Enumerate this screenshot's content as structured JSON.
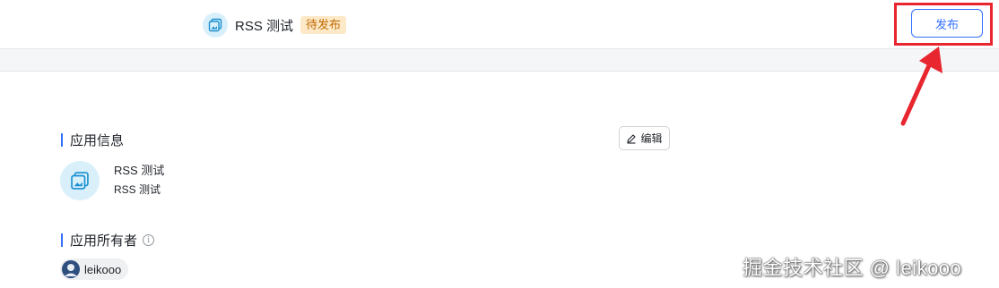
{
  "header": {
    "app_title": "RSS 测试",
    "status_badge": "待发布",
    "publish_label": "发布"
  },
  "app_info": {
    "section_title": "应用信息",
    "edit_label": "编辑",
    "app_name": "RSS 测试",
    "app_description": "RSS 测试"
  },
  "owner": {
    "section_title": "应用所有者",
    "info_glyph": "i",
    "name": "leikooo"
  },
  "watermark": "掘金技术社区 @ leikooo",
  "colors": {
    "accent": "#3370ff",
    "badge_bg": "#fde9c8",
    "badge_text": "#c06a00",
    "annotation_red": "#e8262f",
    "icon_bg": "#d9f0fb"
  },
  "icons": {
    "app_icon": "app-image-icon",
    "edit_icon": "pencil-icon",
    "info_icon": "info-icon",
    "annotation": "red-arrow"
  }
}
